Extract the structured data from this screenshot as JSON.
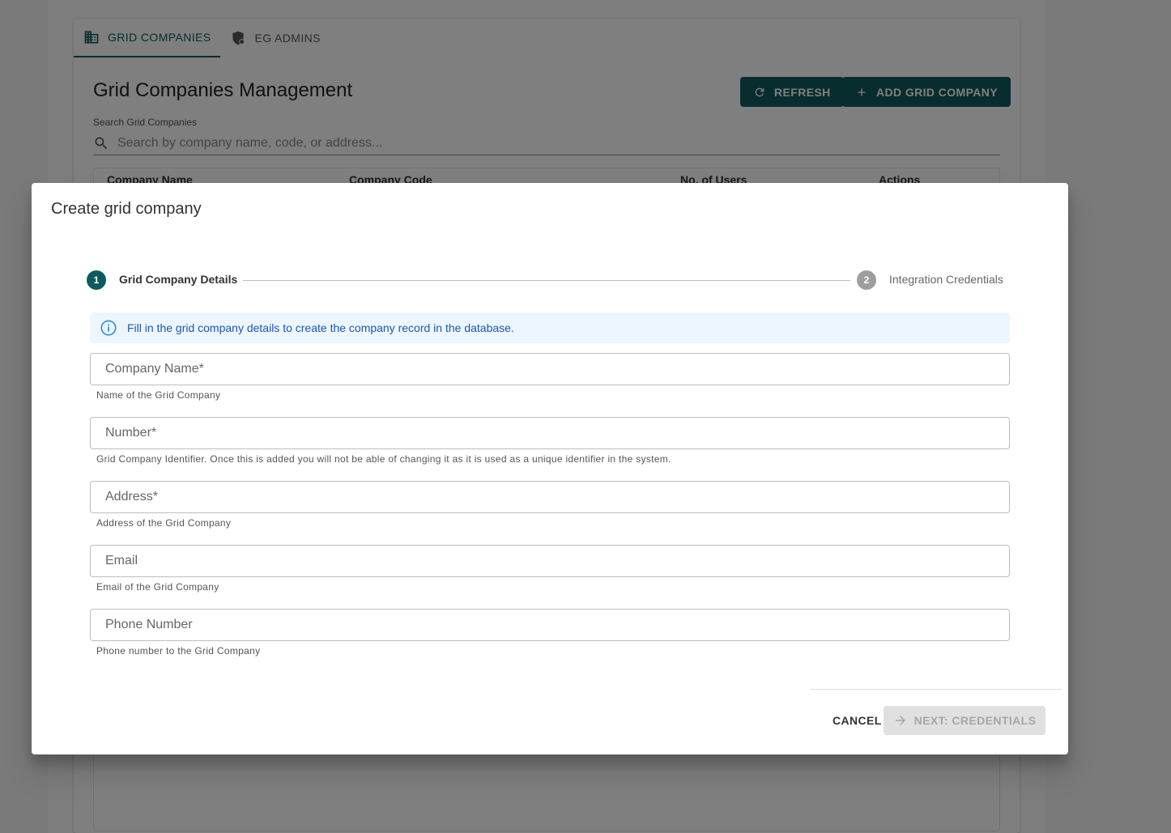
{
  "tabs": [
    {
      "label": "GRID COMPANIES",
      "icon": "building-icon",
      "active": true
    },
    {
      "label": "EG ADMINS",
      "icon": "admin-shield-icon",
      "active": false
    }
  ],
  "management": {
    "title": "Grid Companies Management",
    "refresh_label": "REFRESH",
    "add_label": "ADD GRID COMPANY",
    "search_label": "Search Grid Companies",
    "search_placeholder": "Search by company name, code, or address...",
    "table_headers": [
      "Company Name",
      "Company Code",
      "No. of Users",
      "Actions"
    ]
  },
  "dialog": {
    "title": "Create grid company",
    "steps": [
      {
        "number": "1",
        "label": "Grid Company Details",
        "active": true
      },
      {
        "number": "2",
        "label": "Integration Credentials",
        "active": false
      }
    ],
    "info_text": "Fill in the grid company details to create the company record in the database.",
    "fields": [
      {
        "placeholder": "Company Name*",
        "helper": "Name of the Grid Company"
      },
      {
        "placeholder": "Number*",
        "helper": "Grid Company Identifier. Once this is added you will not be able of changing it as it is used as a unique identifier in the system."
      },
      {
        "placeholder": "Address*",
        "helper": "Address of the Grid Company"
      },
      {
        "placeholder": "Email",
        "helper": "Email of the Grid Company"
      },
      {
        "placeholder": "Phone Number",
        "helper": "Phone number to the Grid Company"
      }
    ],
    "cancel_label": "CANCEL",
    "next_label": "NEXT: CREDENTIALS"
  },
  "colors": {
    "primary": "#0e5a5e",
    "info_bg": "#eef6fd",
    "info_text": "#1a56b6",
    "disabled_bg": "#e0e0e0"
  }
}
